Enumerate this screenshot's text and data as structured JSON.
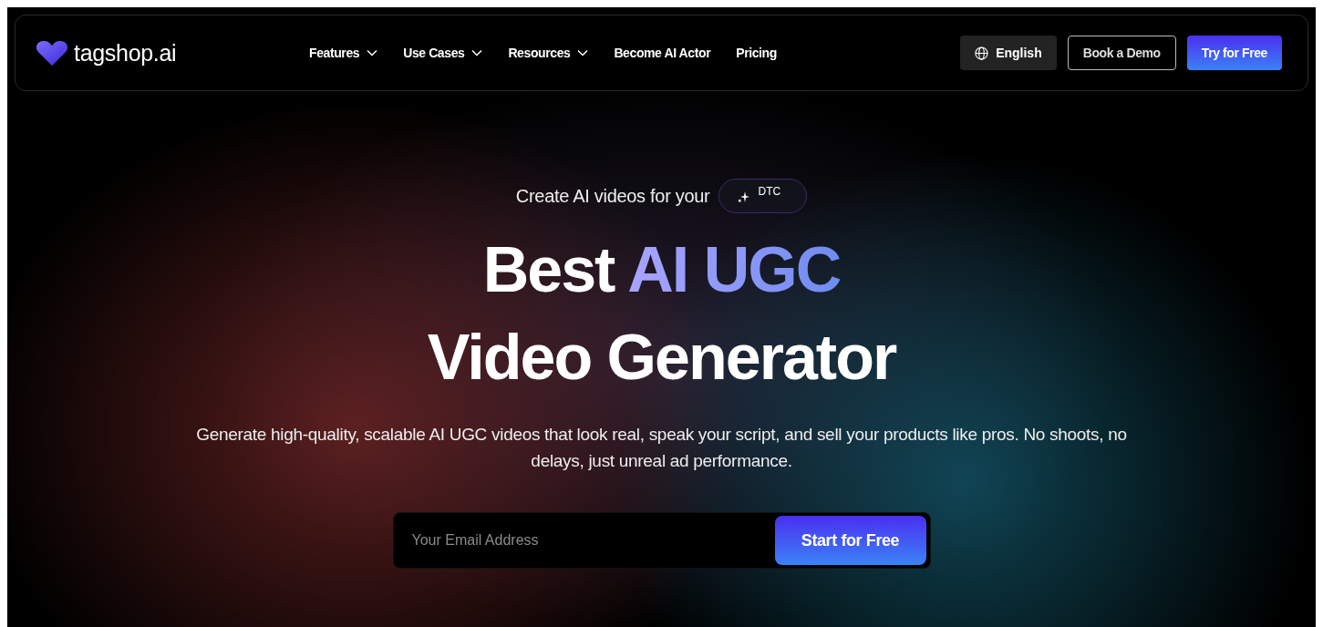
{
  "brand": {
    "name": "tagshop.ai"
  },
  "nav": [
    {
      "label": "Features",
      "kind": "dropdown"
    },
    {
      "label": "Use Cases",
      "kind": "dropdown"
    },
    {
      "label": "Resources",
      "kind": "dropdown"
    },
    {
      "label": "Become AI Actor",
      "kind": "link"
    },
    {
      "label": "Pricing",
      "kind": "link"
    }
  ],
  "language": {
    "label": "English"
  },
  "actions": [
    {
      "label": "Book a Demo",
      "kind": "outline"
    },
    {
      "label": "Try for Free",
      "kind": "primary"
    }
  ],
  "hero": {
    "intro": "Create AI videos for your",
    "rotating_tag": "DTC",
    "headline_lead": "Best",
    "headline_highlight": "AI UGC",
    "headline_line2": "Video Generator",
    "description": "Generate high-quality, scalable AI UGC videos that look real, speak your script, and sell your products like pros. No shoots, no delays, just unreal ad performance.",
    "email": {
      "placeholder": "Your Email Address"
    },
    "cta": "Start for Free"
  }
}
